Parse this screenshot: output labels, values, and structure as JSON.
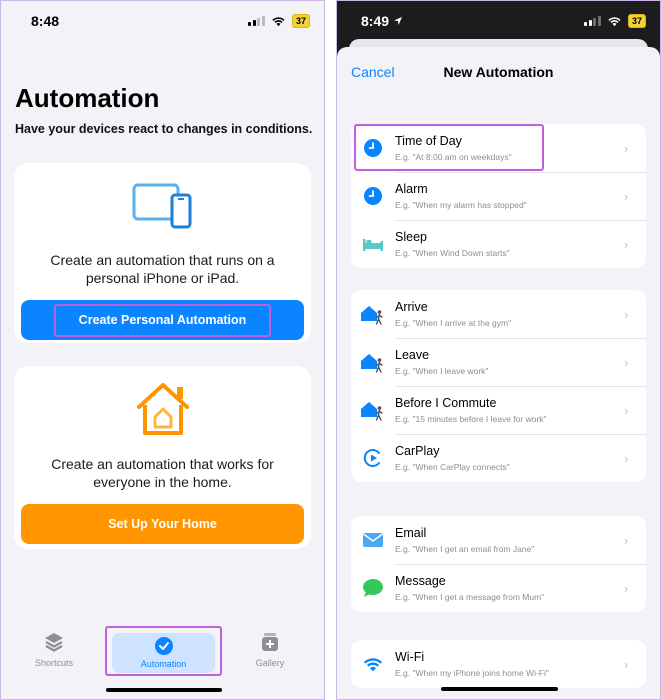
{
  "left": {
    "status": {
      "time": "8:48",
      "battery": "37"
    },
    "title": "Automation",
    "subtitle": "Have your devices react to changes in conditions.",
    "personal_card": {
      "description_line1": "Create an automation that runs on a",
      "description_line2": "personal iPhone or iPad.",
      "button_label": "Create Personal Automation",
      "icon": "devices-icon"
    },
    "home_card": {
      "description_line1": "Create an automation that works for",
      "description_line2": "everyone in the home.",
      "button_label": "Set Up Your Home",
      "icon": "home-icon"
    },
    "tabs": [
      {
        "label": "Shortcuts",
        "icon": "layers-icon"
      },
      {
        "label": "Automation",
        "icon": "automation-check-icon",
        "selected": true
      },
      {
        "label": "Gallery",
        "icon": "gallery-icon"
      }
    ]
  },
  "right": {
    "status": {
      "time": "8:49",
      "battery": "37"
    },
    "nav": {
      "cancel_label": "Cancel",
      "title": "New Automation"
    },
    "groups": [
      [
        {
          "title": "Time of Day",
          "subtitle": "E.g. \"At 8:00 am on weekdays\"",
          "icon": "clock-icon"
        },
        {
          "title": "Alarm",
          "subtitle": "E.g. \"When my alarm has stopped\"",
          "icon": "clock-icon"
        },
        {
          "title": "Sleep",
          "subtitle": "E.g. \"When Wind Down starts\"",
          "icon": "bed-icon"
        }
      ],
      [
        {
          "title": "Arrive",
          "subtitle": "E.g. \"When I arrive at the gym\"",
          "icon": "house-walk-icon"
        },
        {
          "title": "Leave",
          "subtitle": "E.g. \"When I leave work\"",
          "icon": "house-walk-icon"
        },
        {
          "title": "Before I Commute",
          "subtitle": "E.g. \"15 minutes before I leave for work\"",
          "icon": "house-walk-icon"
        },
        {
          "title": "CarPlay",
          "subtitle": "E.g. \"When CarPlay connects\"",
          "icon": "carplay-icon"
        }
      ],
      [
        {
          "title": "Email",
          "subtitle": "E.g. \"When I get an email from Jane\"",
          "icon": "mail-icon"
        },
        {
          "title": "Message",
          "subtitle": "E.g. \"When I get a message from Mum\"",
          "icon": "message-icon"
        }
      ],
      [
        {
          "title": "Wi-Fi",
          "subtitle": "E.g. \"When my iPhone joins home Wi-Fi\"",
          "icon": "wifi-icon"
        }
      ]
    ]
  },
  "colors": {
    "accent": "#0a84ff",
    "orange": "#ff9500",
    "highlight": "#c25ee0"
  }
}
